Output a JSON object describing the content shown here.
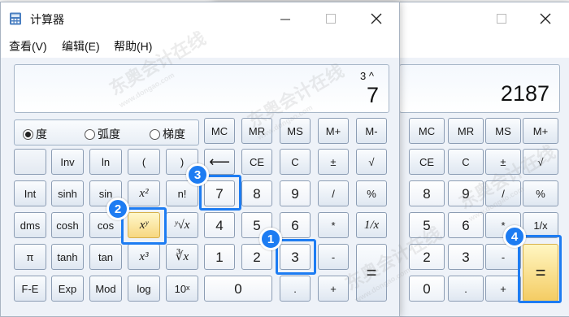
{
  "app": {
    "title": "计算器"
  },
  "menu": {
    "view": "查看(V)",
    "edit": "编辑(E)",
    "help": "帮助(H)"
  },
  "front": {
    "history": "3 ^",
    "value": "7"
  },
  "back": {
    "value": "2187"
  },
  "angle": {
    "degrees": "度",
    "radians": "弧度",
    "grads": "梯度",
    "selected": "度"
  },
  "keys": {
    "mc": "MC",
    "mr": "MR",
    "ms": "MS",
    "mplus": "M+",
    "mminus": "M-",
    "inv": "Inv",
    "ln": "ln",
    "lparen": "(",
    "rparen": ")",
    "backspace": "⟵",
    "ce": "CE",
    "c": "C",
    "pm": "±",
    "sqrt": "√",
    "int": "Int",
    "sinh": "sinh",
    "sin": "sin",
    "x2": "x²",
    "fact": "n!",
    "n7": "7",
    "n8": "8",
    "n9": "9",
    "div": "/",
    "pct": "%",
    "dms": "dms",
    "cosh": "cosh",
    "cos": "cos",
    "xy": "xʸ",
    "yrootx": "ʸ√x",
    "n4": "4",
    "n5": "5",
    "n6": "6",
    "mul": "*",
    "recip": "1/x",
    "pi": "π",
    "tanh": "tanh",
    "tan": "tan",
    "x3": "x³",
    "cuberoot": "∛x",
    "n1": "1",
    "n2": "2",
    "n3": "3",
    "sub": "-",
    "eq": "=",
    "fe": "F-E",
    "exp": "Exp",
    "mod": "Mod",
    "log": "log",
    "tenx": "10ˣ",
    "n0": "0",
    "dot": ".",
    "add": "+"
  },
  "callouts": {
    "c1": "1",
    "c2": "2",
    "c3": "3",
    "c4": "4"
  },
  "watermark": {
    "text": "东奥会计在线",
    "url": "www.dongao.com"
  },
  "colors": {
    "callout": "#1d7cf2",
    "highlight": "#f7d780"
  }
}
